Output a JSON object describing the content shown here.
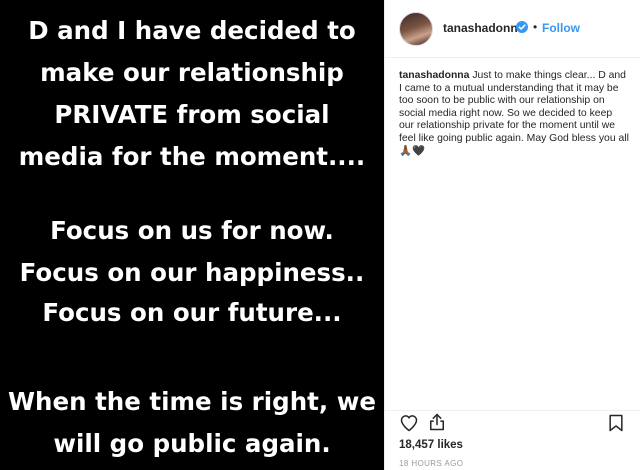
{
  "image": {
    "lines": [
      "D and I have decided to",
      "make our relationship",
      "PRIVATE from social",
      "media for the moment....",
      "Focus on us for now.",
      "Focus on our happiness..",
      "Focus on our future...",
      "When the time is right, we",
      "will go public again."
    ]
  },
  "header": {
    "username": "tanashadonna",
    "separator": "•",
    "follow_label": "Follow"
  },
  "caption": {
    "username": "tanashadonna",
    "text": "Just to make things clear... D and I came to a mutual understanding that it may be too soon to be public with our relationship on social media right now. So we decided to keep our relationship private for the moment until we feel like going public again. May God bless you all 🙏🏾🖤"
  },
  "actions": {
    "icons": [
      "heart-icon",
      "share-icon",
      "bookmark-icon"
    ]
  },
  "likes": {
    "text": "18,457 likes"
  },
  "timestamp": {
    "text": "18 HOURS AGO"
  },
  "colors": {
    "image_bg": "#000000",
    "link_blue": "#3897f0",
    "verified_blue": "#3897f0",
    "text_dark": "#262626",
    "muted": "#999999"
  }
}
